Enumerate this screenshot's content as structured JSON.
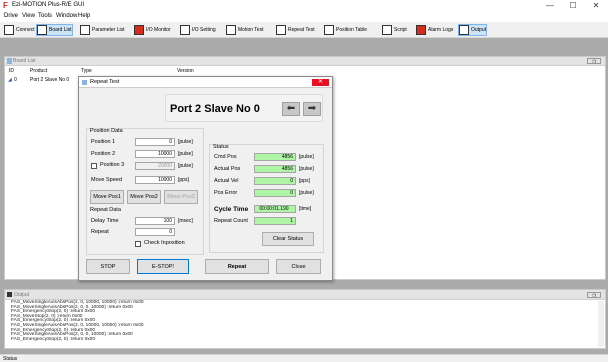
{
  "window": {
    "title": "Ezi-MOTION Plus-R/E GUI",
    "minimize": "—",
    "maximize": "☐",
    "close": "✕"
  },
  "menu": [
    "Drive",
    "View",
    "Tools",
    "Window",
    "Help"
  ],
  "toolbar": [
    {
      "label": "Connect",
      "icon": "connect-icon"
    },
    {
      "label": "Board List",
      "icon": "board-list-icon",
      "active": true
    },
    {
      "label": "Parameter List",
      "icon": "parameter-list-icon"
    },
    {
      "label": "I/O Monitor",
      "icon": "io-monitor-icon"
    },
    {
      "label": "I/O Setting",
      "icon": "io-setting-icon"
    },
    {
      "label": "Motion Test",
      "icon": "motion-test-icon"
    },
    {
      "label": "Repeat Test",
      "icon": "repeat-test-icon"
    },
    {
      "label": "Position Table",
      "icon": "position-table-icon"
    },
    {
      "label": "Script",
      "icon": "script-icon"
    },
    {
      "label": "Alarm Logs",
      "icon": "alarm-logs-icon"
    },
    {
      "label": "Output",
      "icon": "output-icon",
      "active": true
    }
  ],
  "board": {
    "title": "Board List",
    "columns": [
      "ID",
      "Product",
      "Type",
      "Version"
    ],
    "rows": [
      {
        "id": "0",
        "product": "Port 2 Slave No 0"
      }
    ]
  },
  "dialog": {
    "title": "Repeat Test",
    "close": "✕",
    "slave_name": "Port 2 Slave No 0",
    "prev": "⬅",
    "next": "➡",
    "position_data": {
      "title": "Position Data",
      "pos1_label": "Position 1",
      "pos1_value": "0",
      "pos1_unit": "[pulse]",
      "pos2_label": "Position 2",
      "pos2_value": "10000",
      "pos2_unit": "[pulse]",
      "pos3_label": "Position 3",
      "pos3_value": "20000",
      "pos3_unit": "[pulse]",
      "speed_label": "Move Speed",
      "speed_value": "10000",
      "speed_unit": "[pps]",
      "move1": "Move Pos1",
      "move2": "Move Pos2",
      "move3": "Move Pos3"
    },
    "repeat_data": {
      "title": "Repeat Data",
      "delay_label": "Delay Time",
      "delay_value": "100",
      "delay_unit": "[msec]",
      "repeat_label": "Repeat",
      "repeat_value": "0",
      "check_label": "Check Inposition"
    },
    "status": {
      "title": "Status",
      "cmd_label": "Cmd Pos",
      "cmd_value": "4856",
      "cmd_unit": "[pulse]",
      "act_label": "Actual Pos",
      "act_value": "4856",
      "act_unit": "[pulse]",
      "vel_label": "Actual Vel",
      "vel_value": "0",
      "vel_unit": "[pps]",
      "err_label": "Pos Error",
      "err_value": "0",
      "err_unit": "[pulse]",
      "cycle_label": "Cycle Time",
      "cycle_value": "00:00:01.190",
      "cycle_unit": "[time]",
      "rcount_label": "Repeat Count",
      "rcount_value": "1",
      "clear": "Clear Status"
    },
    "buttons": {
      "stop": "STOP",
      "estop": "E-STOP!",
      "repeat": "Repeat",
      "close": "Close"
    }
  },
  "output": {
    "title": "Output",
    "lines": [
      "FAS_MoveSingleAxisAbsPos(2, 0, 10000, 10000) :return 0x00",
      "FAS_MoveSingleAxisAbsPos(2, 0, 0, 10000) :return 0x00",
      "FAS_EmergencyStop(2, 0) :return 0x00",
      "FAS_MoveStop(2, 0) :return 0x00",
      "FAS_EmergencyStop(2, 0) :return 0x00",
      "FAS_MoveSingleAxisAbsPos(2, 0, 10000, 10000) :return 0x00",
      "FAS_EmergencyStop(2, 0) :return 0x00",
      "FAS_MoveSingleAxisAbsPos(2, 0, 0, 10000) :return 0x00",
      "FAS_EmergencyStop(2, 0) :return 0x00"
    ]
  },
  "statusbar": "Status"
}
